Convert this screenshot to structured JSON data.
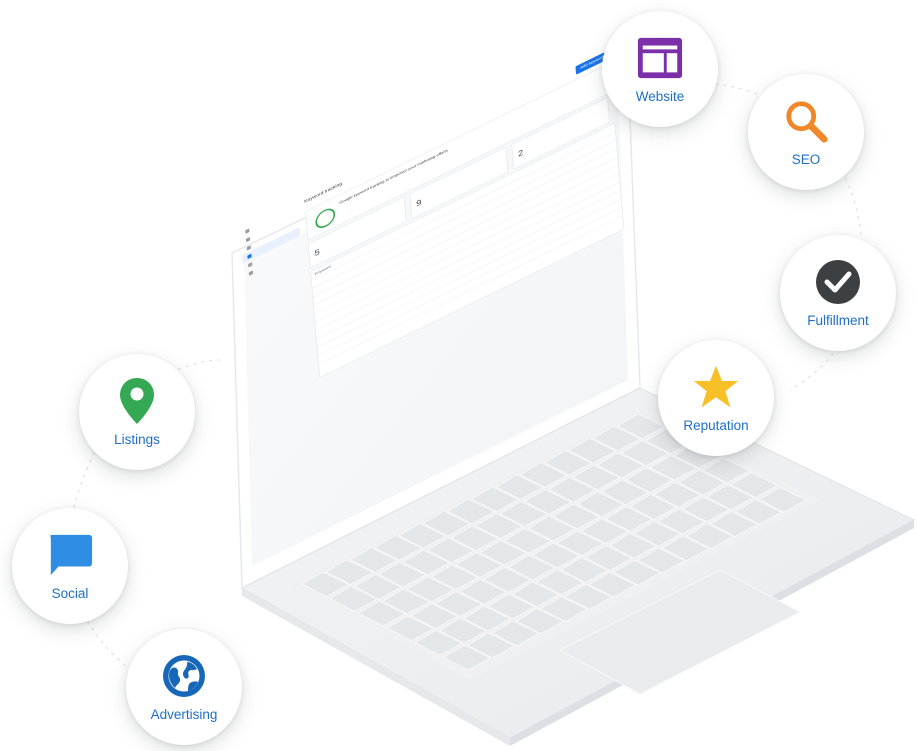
{
  "services": [
    {
      "id": "website",
      "label": "Website",
      "icon": "website-icon",
      "color": "#7b2fa8"
    },
    {
      "id": "seo",
      "label": "SEO",
      "icon": "search-icon",
      "color": "#f0882a"
    },
    {
      "id": "fulfillment",
      "label": "Fulfillment",
      "icon": "checkmark-icon",
      "color": "#3c4043"
    },
    {
      "id": "reputation",
      "label": "Reputation",
      "icon": "star-icon",
      "color": "#f6c026"
    },
    {
      "id": "listings",
      "label": "Listings",
      "icon": "map-pin-icon",
      "color": "#34a853"
    },
    {
      "id": "social",
      "label": "Social",
      "icon": "chat-bubble-icon",
      "color": "#2f8de4"
    },
    {
      "id": "advertising",
      "label": "Advertising",
      "icon": "globe-icon",
      "color": "#1767b8"
    }
  ],
  "screen": {
    "page_title": "Keyword tracking",
    "card_title": "Google keyword tracking to empower your marketing efforts",
    "stat_1": "5",
    "stat_2": "9",
    "stat_3": "2",
    "table_header": "Keyword",
    "cta": "Add keywords"
  }
}
